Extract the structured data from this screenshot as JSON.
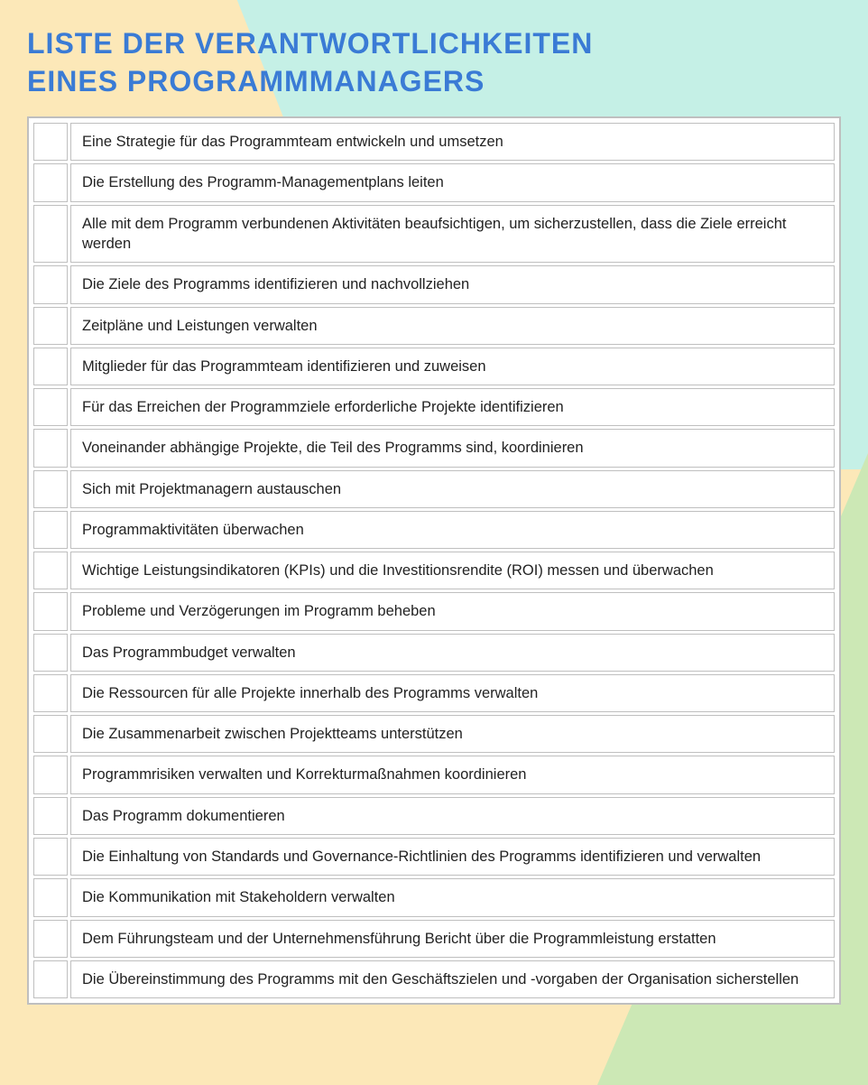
{
  "title": {
    "line1": "LISTE DER VERANTWORTLICHKEITEN",
    "line2": "EINES PROGRAMMMANAGERS"
  },
  "items": [
    "Eine Strategie für das Programmteam entwickeln und umsetzen",
    "Die Erstellung des Programm-Managementplans leiten",
    "Alle mit dem Programm verbundenen Aktivitäten beaufsichtigen, um sicherzustellen, dass die Ziele erreicht werden",
    "Die Ziele des Programms identifizieren und nachvollziehen",
    "Zeitpläne und Leistungen verwalten",
    "Mitglieder für das Programmteam identifizieren und zuweisen",
    "Für das Erreichen der Programmziele erforderliche Projekte identifizieren",
    "Voneinander abhängige Projekte, die Teil des Programms sind, koordinieren",
    "Sich mit Projektmanagern austauschen",
    "Programmaktivitäten überwachen",
    "Wichtige Leistungsindikatoren (KPIs) und die Investitionsrendite (ROI) messen und überwachen",
    "Probleme und Verzögerungen im Programm beheben",
    "Das Programmbudget verwalten",
    "Die Ressourcen für alle Projekte innerhalb des Programms verwalten",
    "Die Zusammenarbeit zwischen Projektteams unterstützen",
    "Programmrisiken verwalten und Korrekturmaßnahmen koordinieren",
    "Das Programm dokumentieren",
    "Die Einhaltung von Standards und Governance-Richtlinien des Programms identifizieren und verwalten",
    "Die Kommunikation mit Stakeholdern verwalten",
    "Dem Führungsteam und der Unternehmensführung Bericht über die Programmleistung erstatten",
    "Die Übereinstimmung des Programms mit den Geschäftszielen und -vorgaben der Organisation sicherstellen"
  ]
}
